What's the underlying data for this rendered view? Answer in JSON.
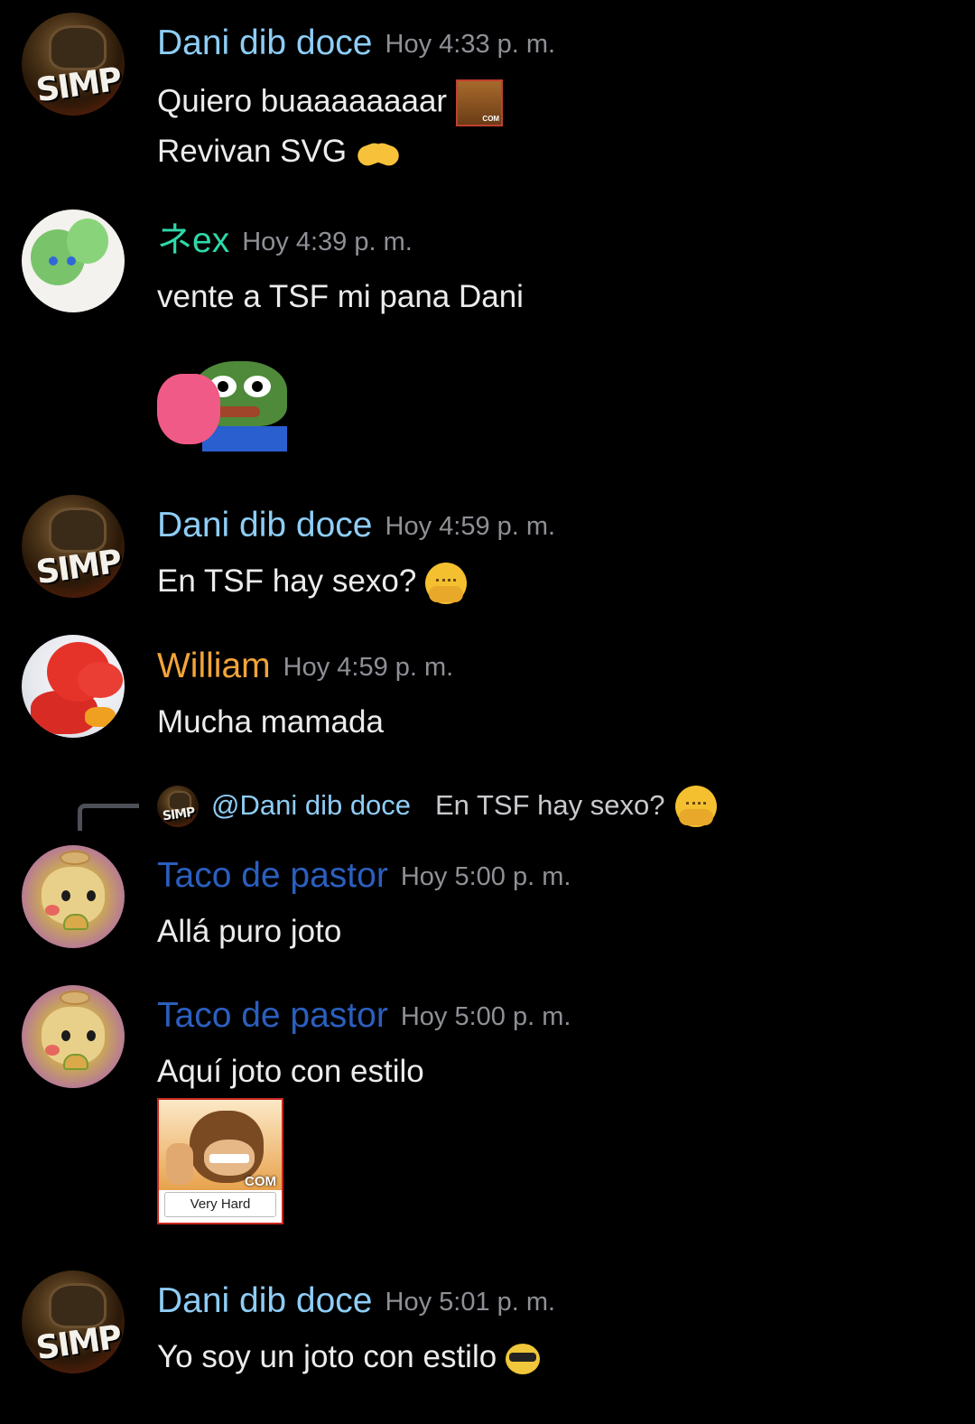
{
  "messages": [
    {
      "author": "Dani dib doce",
      "author_color": "#8ecdf6",
      "time": "Hoy 4:33 p. m.",
      "lines": [
        "Quiero buaaaaaaaar",
        "Revivan SVG"
      ],
      "avatar": "simp-avatar",
      "emojis": [
        "donkey-kong-emoji",
        "handshake-emoji"
      ]
    },
    {
      "author": "ネex",
      "author_color": "#2ed9a9",
      "time": "Hoy 4:39 p. m.",
      "lines": [
        "vente a TSF mi pana Dani"
      ],
      "avatar": "yoshi-avatar",
      "sticker": "pepe-heart-sticker"
    },
    {
      "author": "Dani dib doce",
      "author_color": "#8ecdf6",
      "time": "Hoy 4:59 p. m.",
      "lines": [
        "En TSF hay sexo?"
      ],
      "avatar": "simp-avatar",
      "emojis": [
        "blush-emoji"
      ]
    },
    {
      "author": "William",
      "author_color": "#f2a43a",
      "time": "Hoy 4:59 p. m.",
      "lines": [
        "Mucha mamada"
      ],
      "avatar": "red-yoshi-avatar"
    },
    {
      "author": "Taco de pastor",
      "author_color": "#2b5fbf",
      "time": "Hoy 5:00 p. m.",
      "lines": [
        "Allá puro joto"
      ],
      "avatar": "pikachu-taco-avatar",
      "reply": {
        "mention": "@Dani dib doce",
        "text": "En TSF hay sexo?",
        "emoji": "blush-emoji"
      }
    },
    {
      "author": "Taco de pastor",
      "author_color": "#2b5fbf",
      "time": "Hoy 5:00 p. m.",
      "lines": [
        "Aquí joto con estilo"
      ],
      "avatar": "pikachu-taco-avatar",
      "image": {
        "overlay": "COM",
        "label": "Very Hard"
      }
    },
    {
      "author": "Dani dib doce",
      "author_color": "#8ecdf6",
      "time": "Hoy 5:01 p. m.",
      "lines": [
        "Yo soy un joto con estilo"
      ],
      "avatar": "simp-avatar",
      "emojis": [
        "cool-sunglasses-emoji"
      ]
    }
  ],
  "avatar_text": {
    "simp": "SIMP"
  },
  "colors": {
    "background": "#000000",
    "timestamp": "#8e9096",
    "message_text": "#ececee"
  }
}
